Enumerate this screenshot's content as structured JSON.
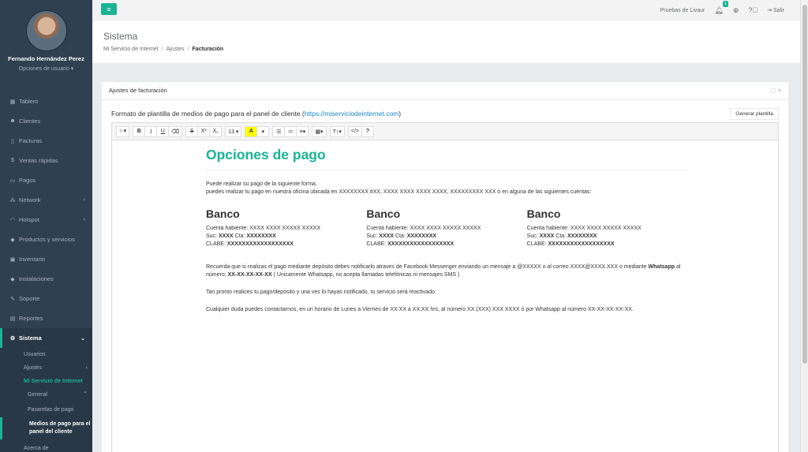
{
  "sidebar": {
    "user_name": "Fernando Hernández Perez",
    "user_options": "Opciones de usuario ▾",
    "items": [
      {
        "label": "Tablero",
        "icon": "dashboard-icon"
      },
      {
        "label": "Clientes",
        "icon": "users-icon"
      },
      {
        "label": "Facturas",
        "icon": "file-icon"
      },
      {
        "label": "Ventas rápidas",
        "icon": "dollar-icon"
      },
      {
        "label": "Pagos",
        "icon": "money-icon"
      },
      {
        "label": "Network",
        "icon": "network-icon"
      },
      {
        "label": "Hotspot",
        "icon": "wifi-icon"
      },
      {
        "label": "Productos y servicios",
        "icon": "tag-icon"
      },
      {
        "label": "Inventario",
        "icon": "cubes-icon"
      },
      {
        "label": "Instalaciones",
        "icon": "tag-icon"
      },
      {
        "label": "Soporte",
        "icon": "wrench-icon"
      },
      {
        "label": "Reportes",
        "icon": "book-icon"
      },
      {
        "label": "Sistema",
        "icon": "cogs-icon"
      }
    ],
    "sub_items": {
      "usuarios": "Usuarios",
      "ajustes": "Ajustes",
      "mi_servicio": "Mi Servicio de Internet",
      "general": "General",
      "pasarelas": "Pasarelas de pago",
      "medios": "Medios de pago para el panel del cliente",
      "acerca": "Acerca de"
    }
  },
  "topbar": {
    "company": "Pruebas de Livaur",
    "notif_count": "1",
    "logout": "Salir"
  },
  "heading": {
    "title": "Sistema",
    "crumb1": "Mi Servicio de Internet",
    "crumb2": "Ajustes",
    "crumb3": "Facturación"
  },
  "panel": {
    "title": "Ajustes de facturación",
    "form_label": "Formato de plantilla de medios de pago para el panel de cliente (",
    "form_link": "https://miserviciodeinternet.com",
    "form_label_end": ")",
    "generate_button": "Generar plantilla"
  },
  "toolbar": {
    "bold": "B",
    "italic": "I",
    "underline": "U",
    "strike": "S",
    "sup": "X²",
    "sub": "X₂",
    "font_size": "13 ▾",
    "highlight": "A",
    "code": "</>",
    "help": "?"
  },
  "template": {
    "title": "Opciones de pago",
    "intro1": "Puede realizar su pago de la siguiente forma.",
    "intro2": "puedes realizar tu pago en nuestra oficina ubicada en XXXXXXXX #XX, XXXX XXXX XXXX XXXX, XXXXXXXXX XXX ó en alguna de las siguientes cuentas:",
    "banks": [
      {
        "name": "Banco",
        "holder": "Cuenta habiente: XXXX XXXX XXXXX XXXXX",
        "suc": "XXXX",
        "cta": "XXXXXXXX",
        "clabe": "XXXXXXXXXXXXXXXXXX"
      },
      {
        "name": "Banco",
        "holder": "Cuenta habiente: XXXX XXXX XXXXX XXXXX",
        "suc": "XXXX",
        "cta": "XXXXXXXX",
        "clabe": "XXXXXXXXXXXXXXXXXX"
      },
      {
        "name": "Banco",
        "holder": "Cuenta habiente: XXXX XXXX XXXXX XXXXX",
        "suc": "XXXX",
        "cta": "XXXXXXXX",
        "clabe": "XXXXXXXXXXXXXXXXXX"
      }
    ],
    "suc_label": "Suc:",
    "cta_label": "Cta:",
    "clabe_label": "CLABE:",
    "notice1": "Recuerda que si realizas el pago mediante depósito debes notificarlo atraves de Facebook Messenger enviando un mensaje a @XXXXX o al correo XXXX@XXXX.XXX o mediante",
    "notice_wa": "Whatsapp",
    "notice_mid": " al número: ",
    "notice_num": "XX-XX-XX-XX-XX",
    "notice_end": " ( Unicamente Whatsapp, no acepta llamadas telefónicas ni mensajes SMS )",
    "reactivation": "Tan pronto realices tu pago/depósito y una ves lo hayas notificado, tu servicio será reactivado.",
    "contact": "Cualquier duda puedes contactarnos, en un horario de Lunes a Viernes de XX:XX a XX:XX hrs, al número XX (XXX) XXX XXXX ó por Whatsapp al número XX-XX-XX-XX-XX."
  }
}
